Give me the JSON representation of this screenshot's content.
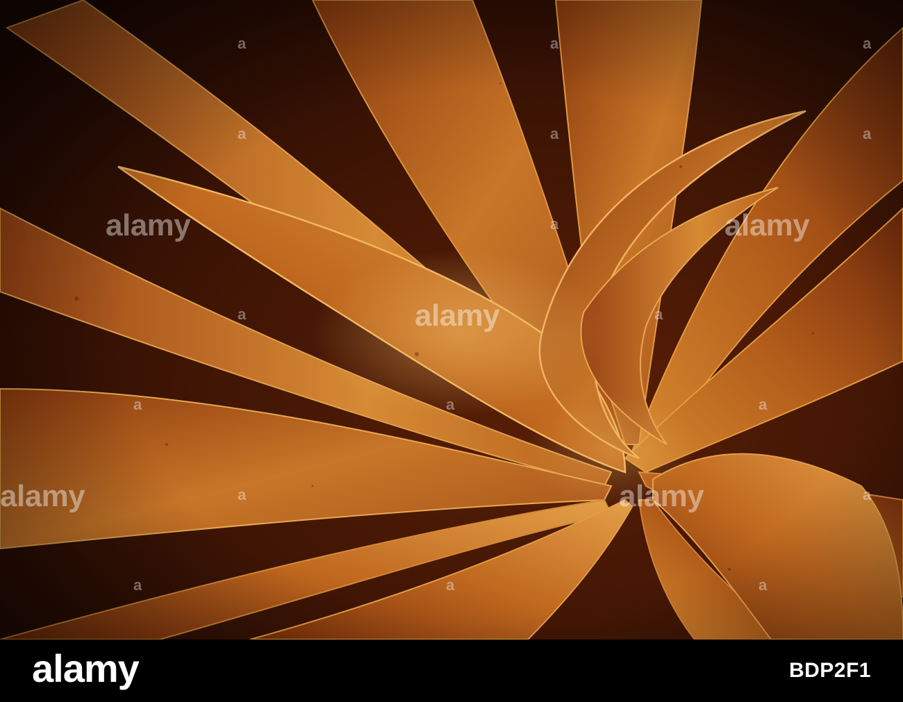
{
  "watermark": {
    "text": "alamy",
    "small_text": "a"
  },
  "footer": {
    "logo": "alamy",
    "image_id": "BDP2F1"
  },
  "colors": {
    "leaf_light": "#e8a040",
    "leaf_mid": "#c06a1c",
    "leaf_dark": "#6a2808",
    "background_dark": "#2a0d03",
    "footer_bg": "#000000",
    "footer_text": "#ffffff"
  }
}
